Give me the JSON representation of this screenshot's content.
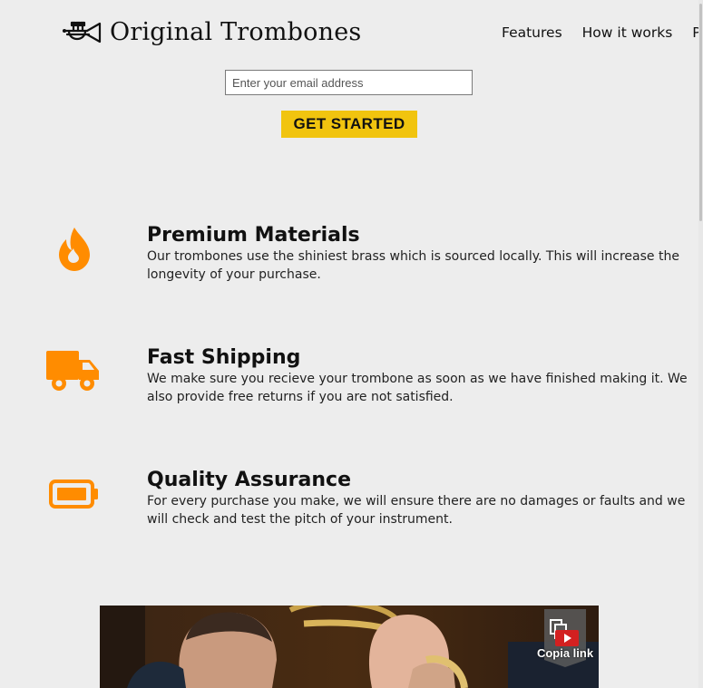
{
  "header": {
    "brand": "Original Trombones",
    "logo_icon": "trumpet-icon",
    "nav": [
      "Features",
      "How it works",
      "Pr"
    ]
  },
  "signup": {
    "placeholder": "Enter your email address",
    "button_label": "GET STARTED"
  },
  "features": [
    {
      "title": "Premium Materials",
      "description": "Our trombones use the shiniest brass which is sourced locally. This will increase the longevity of your purchase.",
      "icon": "fire-icon"
    },
    {
      "title": "Fast Shipping",
      "description": "We make sure you recieve your trombone as soon as we have finished making it. We also provide free returns if you are not satisfied.",
      "icon": "truck-icon"
    },
    {
      "title": "Quality Assurance",
      "description": "For every purchase you make, we will ensure there are no damages or faults and we will check and test the pitch of your instrument.",
      "icon": "battery-icon"
    }
  ],
  "video": {
    "copy_link_label": "Copia link",
    "copy_icon": "copy-link-icon"
  },
  "colors": {
    "accent": "#ff8c00",
    "cta": "#f1c40f",
    "background": "#ededed"
  }
}
